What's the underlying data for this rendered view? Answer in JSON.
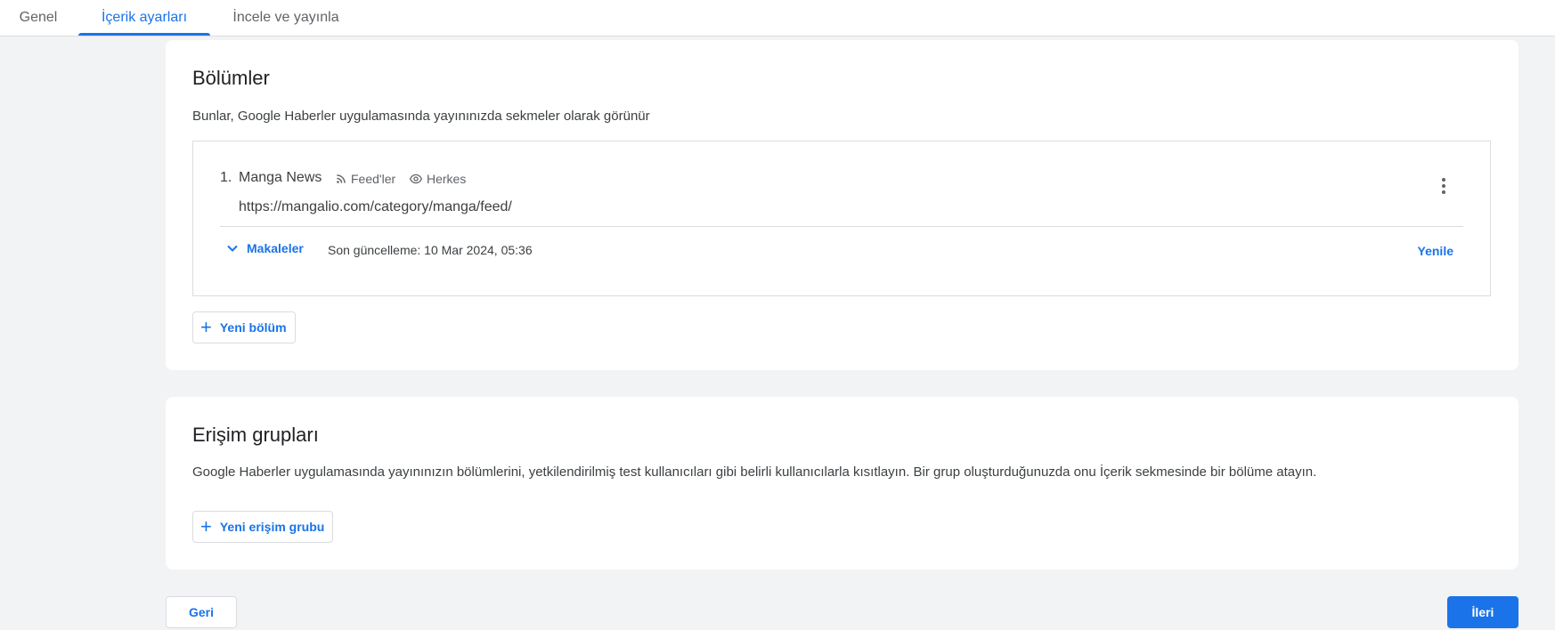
{
  "tabs": [
    {
      "label": "Genel",
      "active": false
    },
    {
      "label": "İçerik ayarları",
      "active": true
    },
    {
      "label": "İncele ve yayınla",
      "active": false
    }
  ],
  "sections_card": {
    "title": "Bölümler",
    "description": "Bunlar, Google Haberler uygulamasında yayınınızda sekmeler olarak görünür",
    "items": [
      {
        "number": "1.",
        "name": "Manga News",
        "type_icon": "rss-feed-icon",
        "type_label": "Feed'ler",
        "visibility_icon": "eye-icon",
        "visibility_label": "Herkes",
        "url": "https://mangalio.com/category/manga/feed/",
        "expand_label": "Makaleler",
        "last_updated": "Son güncelleme: 10 Mar 2024, 05:36",
        "refresh_label": "Yenile"
      }
    ],
    "add_button_label": "Yeni bölüm"
  },
  "access_card": {
    "title": "Erişim grupları",
    "description": "Google Haberler uygulamasında yayınınızın bölümlerini, yetkilendirilmiş test kullanıcıları gibi belirli kullanıcılarla kısıtlayın. Bir grup oluşturduğunuzda onu İçerik sekmesinde bir bölüme atayın.",
    "add_button_label": "Yeni erişim grubu"
  },
  "footer": {
    "back_label": "Geri",
    "next_label": "İleri"
  },
  "colors": {
    "accent": "#1a73e8",
    "background": "#f1f3f4",
    "border": "#dadce0"
  }
}
